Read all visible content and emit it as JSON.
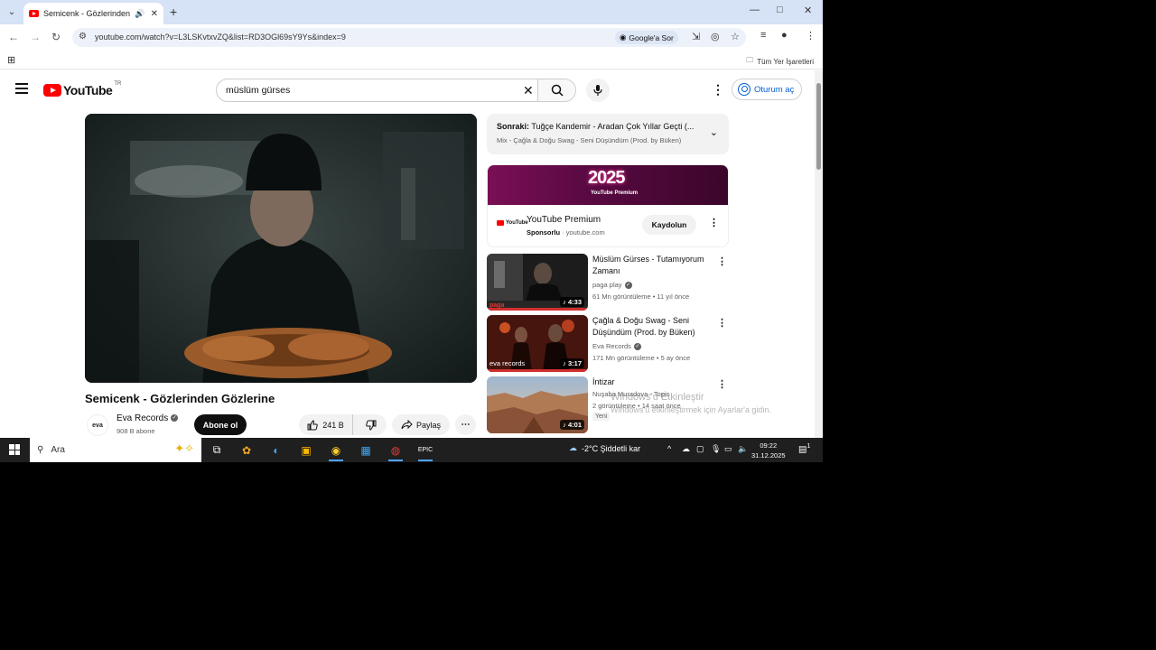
{
  "browser": {
    "tab_title": "Semicenk - Gözlerinden Gö",
    "url": "youtube.com/watch?v=L3LSKvtxvZQ&list=RD3OGl69sY9Ys&index=9",
    "lens_label": "Google'a Sor",
    "bookmarks_all": "Tüm Yer İşaretleri",
    "win_min": "—",
    "win_max": "□",
    "win_close": "✕"
  },
  "youtube": {
    "logo_text": "YouTube",
    "country": "TR",
    "search_value": "müslüm gürses",
    "signin": "Oturum aç"
  },
  "video": {
    "title": "Semicenk - Gözlerinden Gözlerine",
    "channel": "Eva Records",
    "channel_avatar": "eva",
    "subscribers": "908 B abone",
    "subscribe": "Abone ol",
    "likes": "241 B",
    "share": "Paylaş"
  },
  "sidebar": {
    "next_label": "Sonraki:",
    "next_title": "Tuğçe Kandemir - Aradan Çok Yıllar Geçti (...",
    "next_sub": "Mix - Çağla & Doğu Swag - Seni Düşündüm (Prod. by Büken)",
    "ad": {
      "banner_text": "2025",
      "banner_sub": "YouTube Premium",
      "logo_text": "YouTube",
      "name": "YouTube Premium",
      "sponsored": "Sponsorlu",
      "domain": "youtube.com",
      "cta": "Kaydolun"
    },
    "recs": [
      {
        "title": "Müslüm Gürses - Tutamıyorum Zamanı",
        "channel": "paga play",
        "meta": "61 Mn görüntüleme • 11 yıl önce",
        "duration": "4:33",
        "thumb_label": "paga"
      },
      {
        "title": "Çağla & Doğu Swag - Seni Düşündüm (Prod. by Büken)",
        "channel": "Eva Records",
        "meta": "171 Mn görüntüleme • 5 ay önce",
        "duration": "3:17",
        "thumb_label": "eva records"
      },
      {
        "title": "İntizar",
        "channel": "Nuşaba Muradova - Topic",
        "meta": "2 görüntüleme • 14 saat önce",
        "duration": "4:01",
        "badge": "Yeni"
      }
    ]
  },
  "watermark": {
    "line1": "Windows'u Etkinleştir",
    "line2": "Windows'u etkinleştirmek için Ayarlar'a gidin."
  },
  "taskbar": {
    "search_placeholder": "Ara",
    "weather": "-2°C  Şiddetli kar",
    "time": "09:22",
    "date": "31.12.2025",
    "notif_count": "1"
  }
}
